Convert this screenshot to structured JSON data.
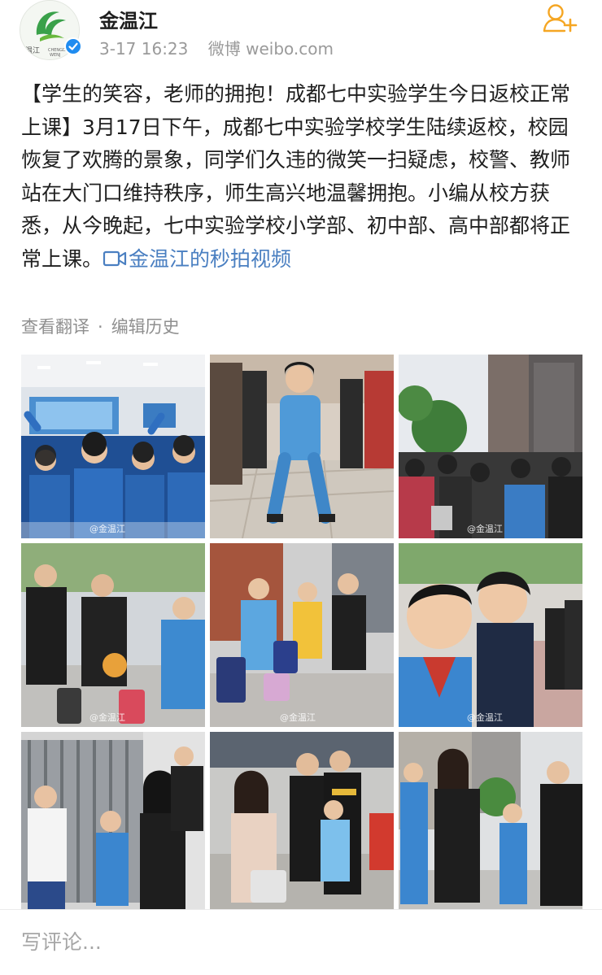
{
  "user": {
    "name": "金温江",
    "avatar_icon": "jinwenjiang-logo-avatar",
    "verified_icon": "verified-badge-icon",
    "timestamp": "3-17 16:23",
    "source": "微博 weibo.com"
  },
  "follow": {
    "icon": "add-user-icon",
    "color": "#f5a623"
  },
  "post": {
    "text": "【学生的笑容，老师的拥抱！成都七中实验学生今日返校正常上课】3月17日下午，成都七中实验学校学生陆续返校，校园恢复了欢腾的景象，同学们久违的微笑一扫疑虑，校警、教师站在大门口维持秩序，师生高兴地温馨拥抱。小编从校方获悉，从今晚起，七中实验学校小学部、初中部、高中部都将正常上课。",
    "video_link": "金温江的秒拍视频",
    "link_color": "#4a7fc1"
  },
  "actions": {
    "translate": "查看翻译",
    "separator": "·",
    "history": "编辑历史"
  },
  "photos": [
    {
      "name": "classroom-cheering-students-photo",
      "watermark": "@金温江"
    },
    {
      "name": "smiling-girl-walking-photo",
      "watermark": ""
    },
    {
      "name": "school-gate-crowd-photo",
      "watermark": "@金温江"
    },
    {
      "name": "teacher-greeting-students-luggage-photo",
      "watermark": "@金温江"
    },
    {
      "name": "students-with-suitcases-photo",
      "watermark": "@金温江"
    },
    {
      "name": "teacher-hugging-boy-photo",
      "watermark": "@金温江"
    },
    {
      "name": "teachers-welcoming-at-gate-photo",
      "watermark": ""
    },
    {
      "name": "police-guarding-entrance-photo",
      "watermark": ""
    },
    {
      "name": "teachers-walking-with-boys-photo",
      "watermark": ""
    }
  ],
  "comment": {
    "placeholder": "写评论..."
  }
}
